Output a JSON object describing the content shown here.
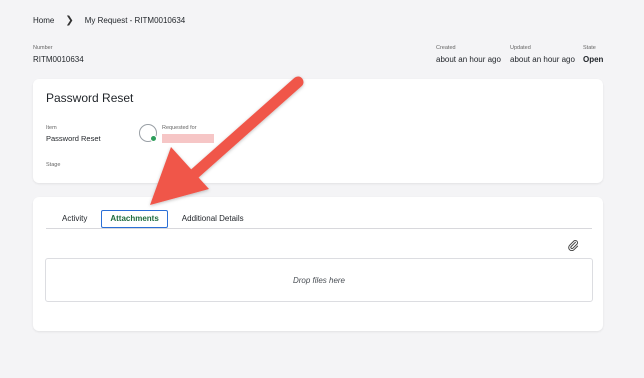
{
  "breadcrumb": {
    "home": "Home",
    "current": "My Request - RITM0010634"
  },
  "meta": {
    "number_label": "Number",
    "number_value": "RITM0010634",
    "created_label": "Created",
    "created_value": "about an hour ago",
    "updated_label": "Updated",
    "updated_value": "about an hour ago",
    "state_label": "State",
    "state_value": "Open"
  },
  "summary": {
    "title": "Password Reset",
    "item_label": "Item",
    "item_value": "Password Reset",
    "requested_for_label": "Requested for",
    "stage_label": "Stage"
  },
  "tabs": [
    {
      "label": "Activity",
      "active": false
    },
    {
      "label": "Attachments",
      "active": true
    },
    {
      "label": "Additional Details",
      "active": false
    }
  ],
  "attachments": {
    "icon": "paperclip-icon",
    "dropzone_text": "Drop files here"
  },
  "colors": {
    "accent_active_tab": "#1e6b3e",
    "tab_focus_border": "#2b6fd6",
    "status_dot": "#2e9e5b",
    "annotation_arrow": "#f0564a"
  }
}
